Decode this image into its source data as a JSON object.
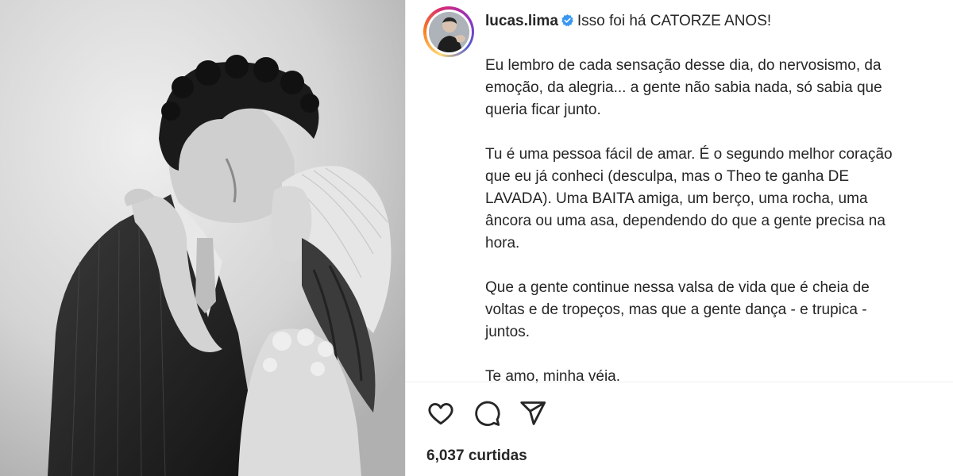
{
  "post": {
    "username": "lucas.lima",
    "caption_first_line": "Isso foi há CATORZE ANOS!",
    "paragraphs": [
      "Eu lembro de cada sensação desse dia, do nervosismo, da\nemoção, da alegria... a gente não sabia nada, só sabia que\nqueria ficar junto.",
      "Tu é uma pessoa fácil de amar. É o segundo melhor coração\nque eu já conheci (desculpa, mas o Theo te ganha DE\nLAVADA). Uma BAITA amiga, um berço, uma rocha, uma\nâncora ou uma asa, dependendo do que a gente precisa na\nhora.",
      "Que a gente continue nessa valsa de vida que é cheia de\nvoltas e de tropeços, mas que a gente dança - e trupica -\njuntos.",
      "Te amo, minha véia."
    ],
    "likes_text": "6,037 curtidas"
  },
  "icons": {
    "like": "heart-icon",
    "comment": "comment-bubble-icon",
    "share": "paper-plane-icon",
    "verified": "verified-badge-icon"
  },
  "colors": {
    "text": "#262626",
    "verified": "#3897f0",
    "divider": "#efefef"
  }
}
